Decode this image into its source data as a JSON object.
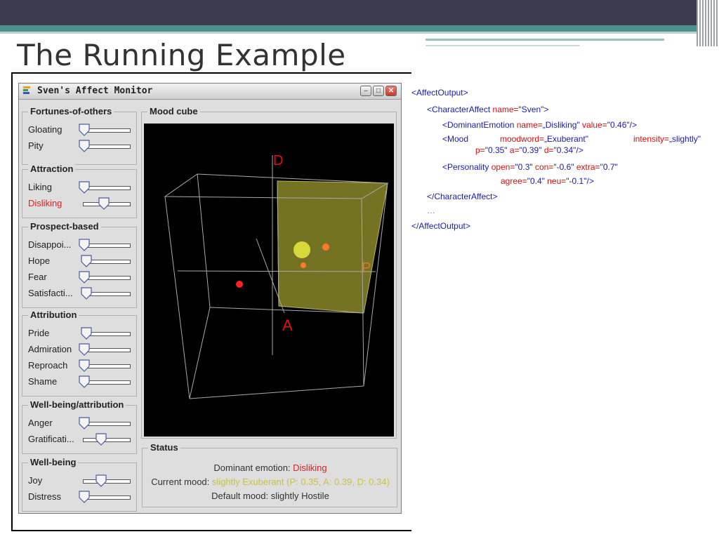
{
  "slide": {
    "title": "The Running Example"
  },
  "window": {
    "title": "Sven's Affect Monitor",
    "buttons": {
      "minimize": "–",
      "maximize": "□",
      "close": "✕"
    }
  },
  "groups": [
    {
      "label": "Fortunes-of-others",
      "rows": [
        {
          "label": "Gloating",
          "value": 0.0
        },
        {
          "label": "Pity",
          "value": 0.0
        }
      ]
    },
    {
      "label": "Attraction",
      "rows": [
        {
          "label": "Liking",
          "value": 0.0
        },
        {
          "label": "Disliking",
          "value": 0.46,
          "highlight": true
        }
      ]
    },
    {
      "label": "Prospect-based",
      "rows": [
        {
          "label": "Disappoi...",
          "value": 0.0
        },
        {
          "label": "Hope",
          "value": 0.05
        },
        {
          "label": "Fear",
          "value": 0.0
        },
        {
          "label": "Satisfacti...",
          "value": 0.05
        }
      ]
    },
    {
      "label": "Attribution",
      "rows": [
        {
          "label": "Pride",
          "value": 0.05
        },
        {
          "label": "Admiration",
          "value": 0.0
        },
        {
          "label": "Reproach",
          "value": 0.0
        },
        {
          "label": "Shame",
          "value": 0.0
        }
      ]
    },
    {
      "label": "Well-being/attribution",
      "rows": [
        {
          "label": "Anger",
          "value": 0.0
        },
        {
          "label": "Gratificati...",
          "value": 0.4
        }
      ]
    },
    {
      "label": "Well-being",
      "rows": [
        {
          "label": "Joy",
          "value": 0.4
        },
        {
          "label": "Distress",
          "value": 0.0
        }
      ]
    }
  ],
  "mood_cube": {
    "label": "Mood cube",
    "axis_labels": {
      "d": "D",
      "p": "P",
      "a": "A"
    }
  },
  "status": {
    "label": "Status",
    "dominant_prefix": "Dominant emotion: ",
    "dominant_value": "Disliking",
    "current_prefix": "Current mood: ",
    "current_value": "slightly Exuberant (P: 0.35, A: 0.39, D: 0.34)",
    "default_text": "Default mood: slightly Hostile"
  },
  "xml": {
    "l1": "<AffectOutput>",
    "l2_open": "<CharacterAffect",
    "l2_attr": "name=",
    "l2_val": "\"Sven\">",
    "l3_open": "<DominantEmotion",
    "l3_attr1": "name=",
    "l3_val1": "„Disliking\"",
    "l3_attr2": "value=",
    "l3_val2": "\"0.46\"/>",
    "l4_open": "<Mood",
    "l4_attr1": "moodword=",
    "l4_val1": "„Exuberant\"",
    "l4_attr2": "intensity=",
    "l4_val2": "„slightly\"",
    "l5_attr1": "p=",
    "l5_val1": "\"0.35\"",
    "l5_attr2": "a=",
    "l5_val2": "\"0.39\"",
    "l5_attr3": "d=",
    "l5_val3": "\"0.34\"/>",
    "l6_open": "<Personality",
    "l6_attr1": "open=",
    "l6_val1": "\"0.3\"",
    "l6_attr2": "con=",
    "l6_val2": "\"-0.6\"",
    "l6_attr3": "extra=",
    "l6_val3": "\"0.7\"",
    "l7_attr1": "agree=",
    "l7_val1": "\"0.4\"",
    "l7_attr2": "neu=",
    "l7_val2": "\"-0.1\"/>",
    "l8": "</CharacterAffect>",
    "l9": "…",
    "l10": "</AffectOutput>"
  },
  "colors": {
    "slide_dark": "#3b3d4e",
    "slide_teal": "#4f8f8e",
    "highlight_red": "#e02020",
    "mood_yellow": "#c9c23c",
    "xml_tag": "#1a1aaa",
    "xml_attr": "#d01010"
  }
}
